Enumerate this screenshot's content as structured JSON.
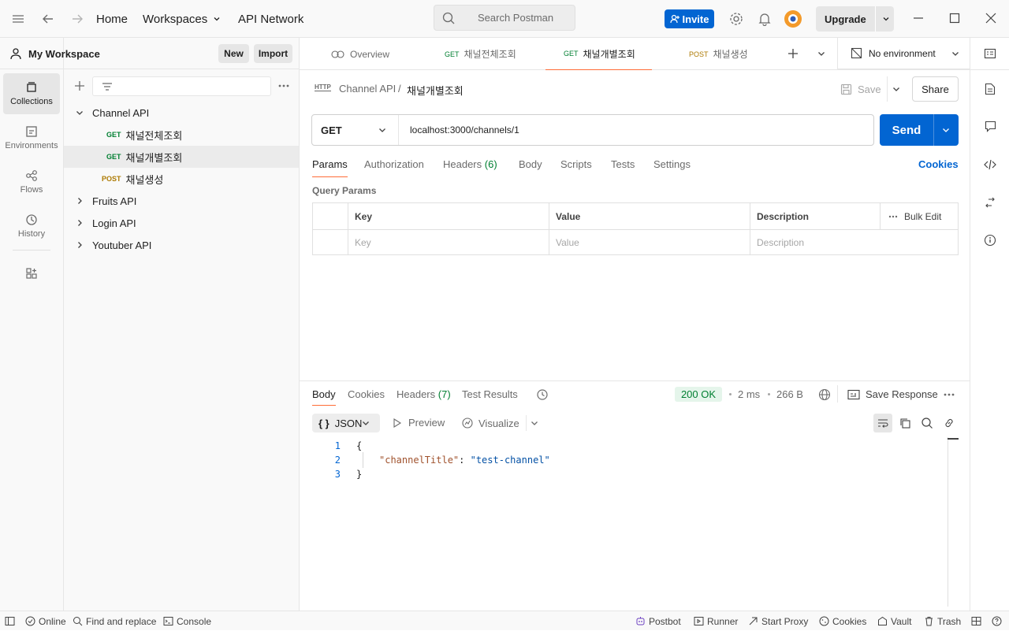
{
  "topbar": {
    "home": "Home",
    "workspaces": "Workspaces",
    "api_network": "API Network",
    "search_placeholder": "Search Postman",
    "invite": "Invite",
    "upgrade": "Upgrade"
  },
  "rail": {
    "items": [
      {
        "label": "Collections",
        "icon": "collections-icon"
      },
      {
        "label": "Environments",
        "icon": "environments-icon"
      },
      {
        "label": "Flows",
        "icon": "flows-icon"
      },
      {
        "label": "History",
        "icon": "history-icon"
      }
    ]
  },
  "sidebar": {
    "workspace": "My Workspace",
    "new_label": "New",
    "import_label": "Import",
    "tree": [
      {
        "label": "Channel API"
      },
      {
        "method": "GET",
        "label": "채널전체조회"
      },
      {
        "method": "GET",
        "label": "채널개별조회"
      },
      {
        "method": "POST",
        "label": "채널생성"
      },
      {
        "label": "Fruits API"
      },
      {
        "label": "Login API"
      },
      {
        "label": "Youtuber API"
      }
    ]
  },
  "tabs": [
    {
      "label": "Overview"
    },
    {
      "method": "GET",
      "label": "채널전체조회"
    },
    {
      "method": "GET",
      "label": "채널개별조회"
    },
    {
      "method": "POST",
      "label": "채널생성"
    }
  ],
  "environment": "No environment",
  "request": {
    "breadcrumb_parent": "Channel API",
    "breadcrumb_sep": "/",
    "title": "채널개별조회",
    "http_badge": "HTTP",
    "save_label": "Save",
    "share_label": "Share",
    "method": "GET",
    "url": "localhost:3000/channels/1",
    "send_label": "Send",
    "tabs": [
      "Params",
      "Authorization",
      "Headers",
      "Body",
      "Scripts",
      "Tests",
      "Settings"
    ],
    "headers_count": "(6)",
    "cookies_label": "Cookies",
    "query_params_label": "Query Params",
    "table": {
      "headers": [
        "Key",
        "Value",
        "Description"
      ],
      "bulk_edit": "Bulk Edit",
      "placeholders": [
        "Key",
        "Value",
        "Description"
      ]
    }
  },
  "response": {
    "tabs": [
      "Body",
      "Cookies",
      "Headers",
      "Test Results"
    ],
    "headers_count": "(7)",
    "status": "200 OK",
    "time": "2 ms",
    "size": "266 B",
    "save_response": "Save Response",
    "format": "JSON",
    "format_braces": "{ }",
    "preview": "Preview",
    "visualize": "Visualize",
    "lines": [
      {
        "n": "1",
        "text": "{"
      },
      {
        "n": "2",
        "key": "\"channelTitle\"",
        "colon": ": ",
        "value": "\"test-channel\""
      },
      {
        "n": "3",
        "text": "}"
      }
    ]
  },
  "statusbar": {
    "online": "Online",
    "find_replace": "Find and replace",
    "console": "Console",
    "postbot": "Postbot",
    "runner": "Runner",
    "start_proxy": "Start Proxy",
    "cookies": "Cookies",
    "vault": "Vault",
    "trash": "Trash"
  },
  "colors": {
    "accent": "#ff6c37",
    "primary": "#0265d2",
    "get": "#007f31",
    "post": "#ad7a03",
    "status_ok": "#007f31"
  }
}
